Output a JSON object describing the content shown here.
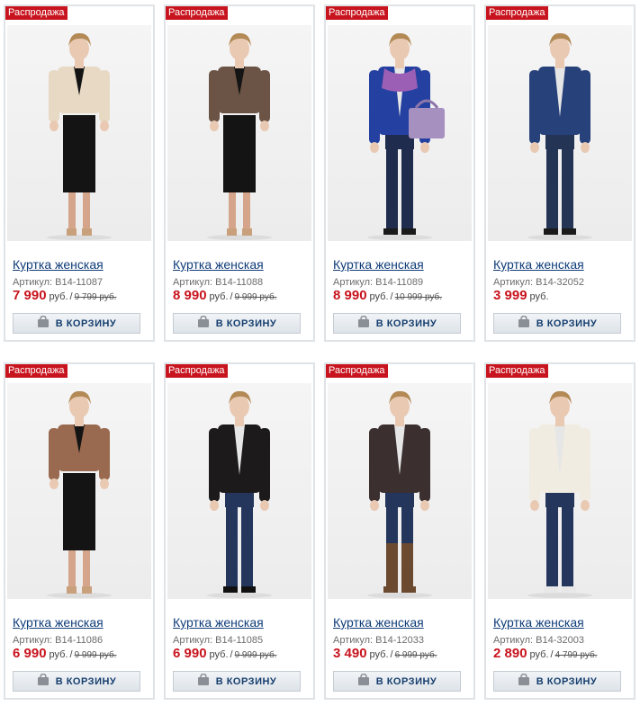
{
  "sale_label": "Распродажа",
  "buy_label": "В КОРЗИНУ",
  "sku_prefix": "Артикул:",
  "currency": "руб.",
  "colors": {
    "sale": "#c8141e",
    "link": "#0f3c78",
    "price": "#c8141e"
  },
  "products": [
    {
      "title": "Куртка женская",
      "sku": "B14-11087",
      "price": "7 990",
      "old_price": "9 799 руб.",
      "jacket": "#e8d9c5",
      "bottom": "#141414",
      "legs": "#d4a58a",
      "shoes": "#c9a07c",
      "bottom_type": "dress",
      "acc": ""
    },
    {
      "title": "Куртка женская",
      "sku": "B14-11088",
      "price": "8 990",
      "old_price": "9 999 руб.",
      "jacket": "#6b5446",
      "bottom": "#141414",
      "legs": "#d4a58a",
      "shoes": "#c9a07c",
      "bottom_type": "dress",
      "acc": ""
    },
    {
      "title": "Куртка женская",
      "sku": "B14-11089",
      "price": "8 990",
      "old_price": "10 999 руб.",
      "jacket": "#2440a0",
      "bottom": "#1f2c4d",
      "legs": "#1f2c4d",
      "shoes": "#1a1a1a",
      "bottom_type": "jeans",
      "acc": "bag"
    },
    {
      "title": "Куртка женская",
      "sku": "B14-32052",
      "price": "3 999",
      "old_price": "",
      "jacket": "#27417a",
      "bottom": "#233455",
      "legs": "#233455",
      "shoes": "#1a1a1a",
      "bottom_type": "jeans",
      "acc": ""
    },
    {
      "title": "Куртка женская",
      "sku": "B14-11086",
      "price": "6 990",
      "old_price": "9 999 руб.",
      "jacket": "#9a6a50",
      "bottom": "#141414",
      "legs": "#d4a58a",
      "shoes": "#c9a07c",
      "bottom_type": "dress",
      "acc": ""
    },
    {
      "title": "Куртка женская",
      "sku": "B14-11085",
      "price": "6 990",
      "old_price": "9 999 руб.",
      "jacket": "#1c1a1a",
      "bottom": "#24365c",
      "legs": "#24365c",
      "shoes": "#111111",
      "bottom_type": "jeans",
      "acc": ""
    },
    {
      "title": "Куртка женская",
      "sku": "B14-12033",
      "price": "3 490",
      "old_price": "6 999 руб.",
      "jacket": "#3b2f30",
      "bottom": "#24365c",
      "legs": "#24365c",
      "shoes": "#6b4a30",
      "bottom_type": "jeans",
      "acc": "boots"
    },
    {
      "title": "Куртка женская",
      "sku": "B14-32003",
      "price": "2 890",
      "old_price": "4 799 руб.",
      "jacket": "#f1ece2",
      "bottom": "#24365c",
      "legs": "#24365c",
      "shoes": "#e8e8e8",
      "bottom_type": "jeans",
      "acc": ""
    }
  ]
}
